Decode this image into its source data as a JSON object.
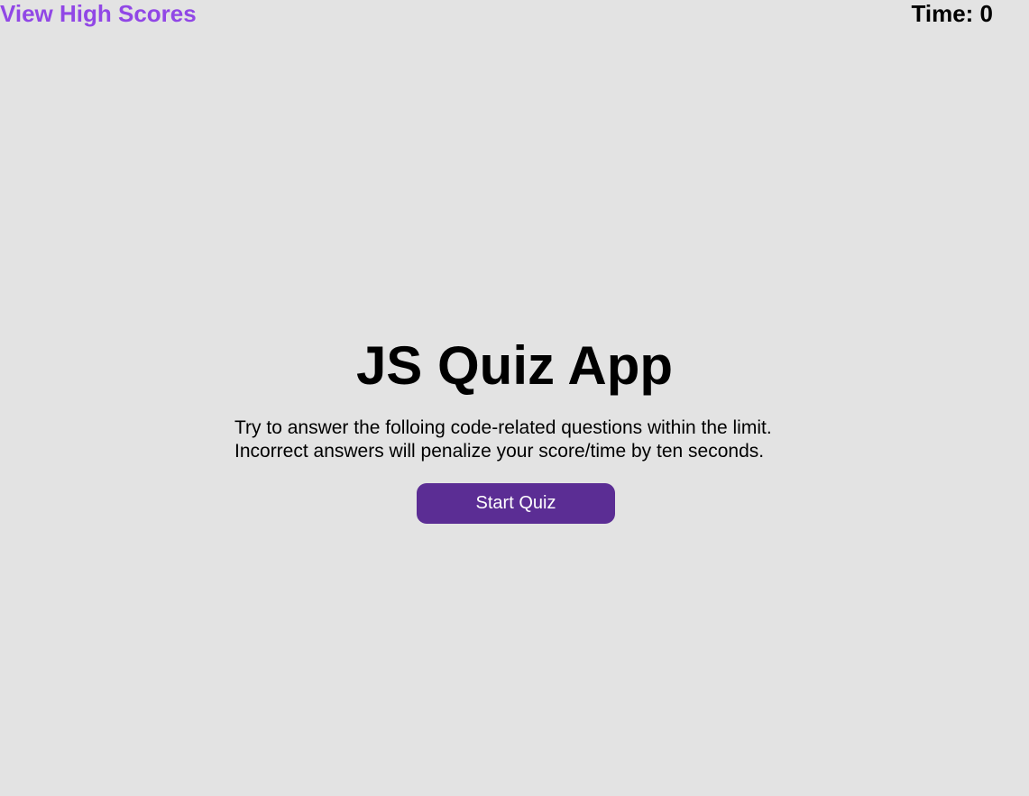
{
  "header": {
    "high_scores_label": "View High Scores",
    "timer_text": "Time: 0"
  },
  "main": {
    "title": "JS Quiz App",
    "instructions": [
      "Try to answer the folloing code-related questions within the limit.",
      "Incorrect answers will penalize your score/time by ten seconds."
    ],
    "start_button_label": "Start Quiz"
  },
  "colors": {
    "background": "#e3e3e3",
    "link": "#9147e6",
    "button": "#5b2d94",
    "button_text": "#ffffff",
    "text": "#000000"
  }
}
